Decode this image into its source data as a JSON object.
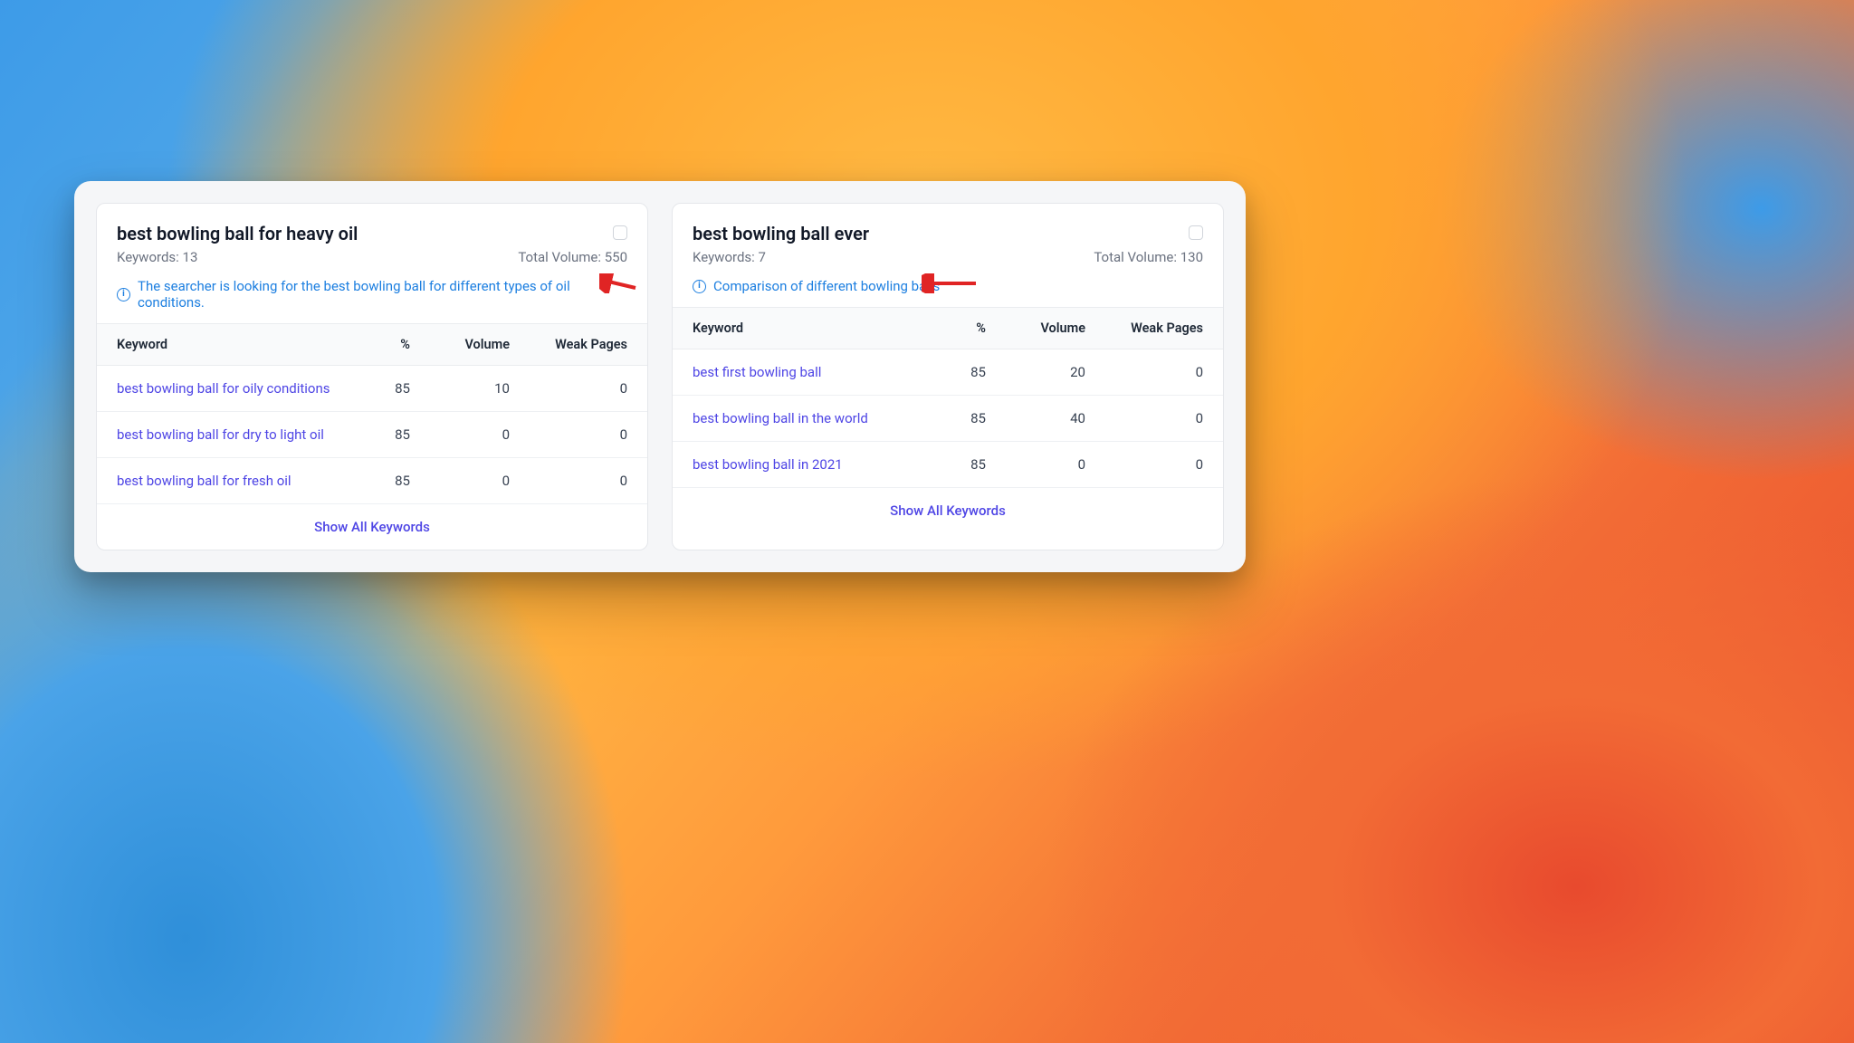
{
  "labels": {
    "keywords_prefix": "Keywords: ",
    "volume_prefix": "Total Volume: ",
    "col_keyword": "Keyword",
    "col_pct": "%",
    "col_volume": "Volume",
    "col_weak": "Weak Pages",
    "show_all": "Show All Keywords"
  },
  "cards": [
    {
      "title": "best bowling ball for heavy oil",
      "keyword_count": "13",
      "total_volume": "550",
      "intent": "The searcher is looking for the best bowling ball for different types of oil conditions.",
      "rows": [
        {
          "kw": "best bowling ball for oily conditions",
          "pct": "85",
          "vol": "10",
          "weak": "0"
        },
        {
          "kw": "best bowling ball for dry to light oil",
          "pct": "85",
          "vol": "0",
          "weak": "0"
        },
        {
          "kw": "best bowling ball for fresh oil",
          "pct": "85",
          "vol": "0",
          "weak": "0"
        }
      ]
    },
    {
      "title": "best bowling ball ever",
      "keyword_count": "7",
      "total_volume": "130",
      "intent": "Comparison of different bowling balls",
      "rows": [
        {
          "kw": "best first bowling ball",
          "pct": "85",
          "vol": "20",
          "weak": "0"
        },
        {
          "kw": "best bowling ball in the world",
          "pct": "85",
          "vol": "40",
          "weak": "0"
        },
        {
          "kw": "best bowling ball in 2021",
          "pct": "85",
          "vol": "0",
          "weak": "0"
        }
      ]
    }
  ],
  "annotations": {
    "arrow_color": "#e02424"
  }
}
